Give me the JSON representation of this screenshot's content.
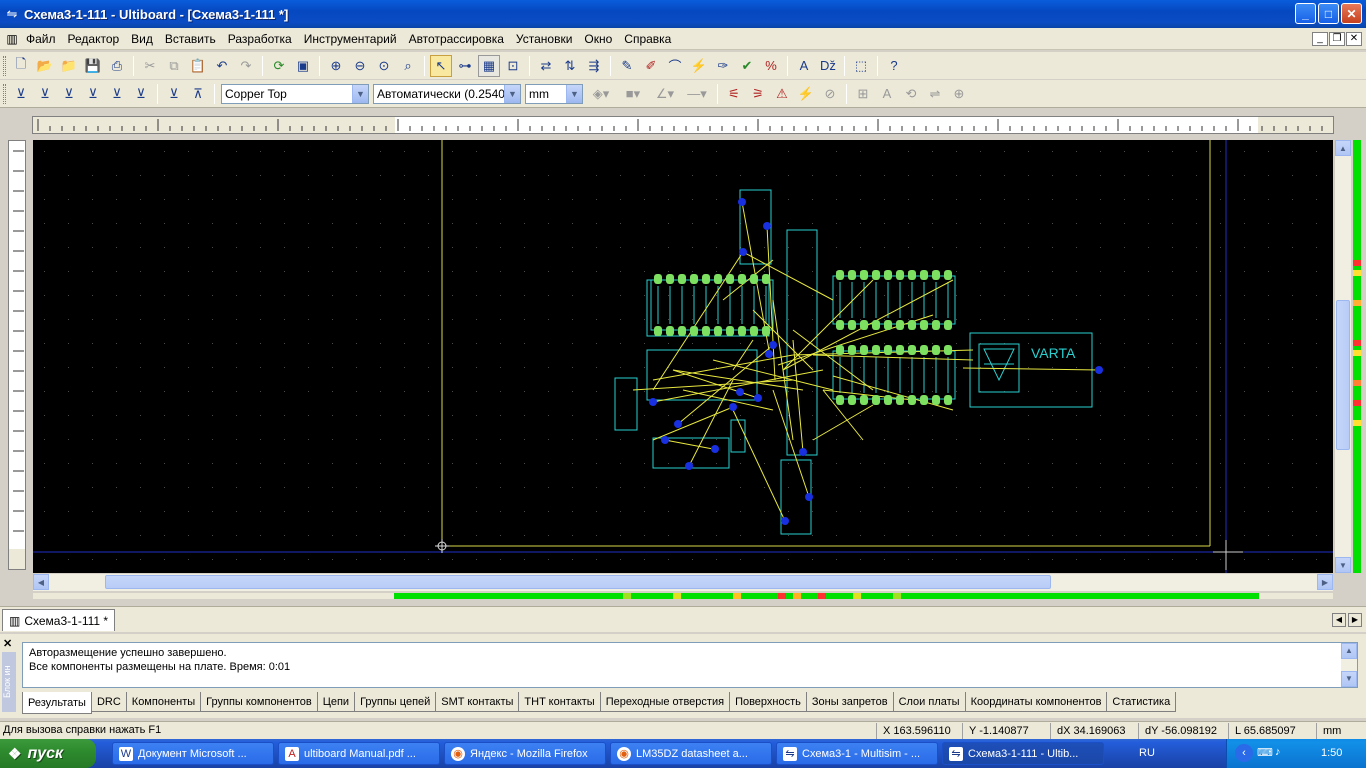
{
  "window": {
    "title": "Схема3-1-111 - Ultiboard - [Схема3-1-111 *]",
    "min": "_",
    "max": "□",
    "close": "✕"
  },
  "menu": [
    "Файл",
    "Редактор",
    "Вид",
    "Вставить",
    "Разработка",
    "Инструментарий",
    "Автотрассировка",
    "Установки",
    "Окно",
    "Справка"
  ],
  "toolbar": {
    "layer": "Copper Top",
    "trace_width": "Автоматически (0.2540",
    "units": "mm"
  },
  "canvas": {
    "component_label": "VARTA"
  },
  "doc_tab": "Схема3-1-111 *",
  "output": {
    "side_label": "Блок ин",
    "lines": [
      "Авторазмещение успешно завершено.",
      "Все компоненты размещены на плате.  Время: 0:01"
    ],
    "tabs": [
      "Результаты",
      "DRC",
      "Компоненты",
      "Группы компонентов",
      "Цепи",
      "Группы цепей",
      "SMT контакты",
      "THT контакты",
      "Переходные отверстия",
      "Поверхность",
      "Зоны запретов",
      "Слои платы",
      "Координаты компонентов",
      "Статистика"
    ]
  },
  "status": {
    "help": "Для вызова справки нажать F1",
    "x": "X 163.596110",
    "y": "Y -1.140877",
    "dx": "dX 34.169063",
    "dy": "dY -56.098192",
    "l": "L 65.685097",
    "unit": "mm"
  },
  "taskbar": {
    "start": "пуск",
    "tasks": [
      "Документ Microsoft ...",
      "ultiboard Manual.pdf ...",
      "Яндекс - Mozilla Firefox",
      "LM35DZ datasheet a...",
      "Схема3-1 - Multisim - ...",
      "Схема3-1-111 - Ultib..."
    ],
    "lang": "RU",
    "clock": "1:50"
  }
}
